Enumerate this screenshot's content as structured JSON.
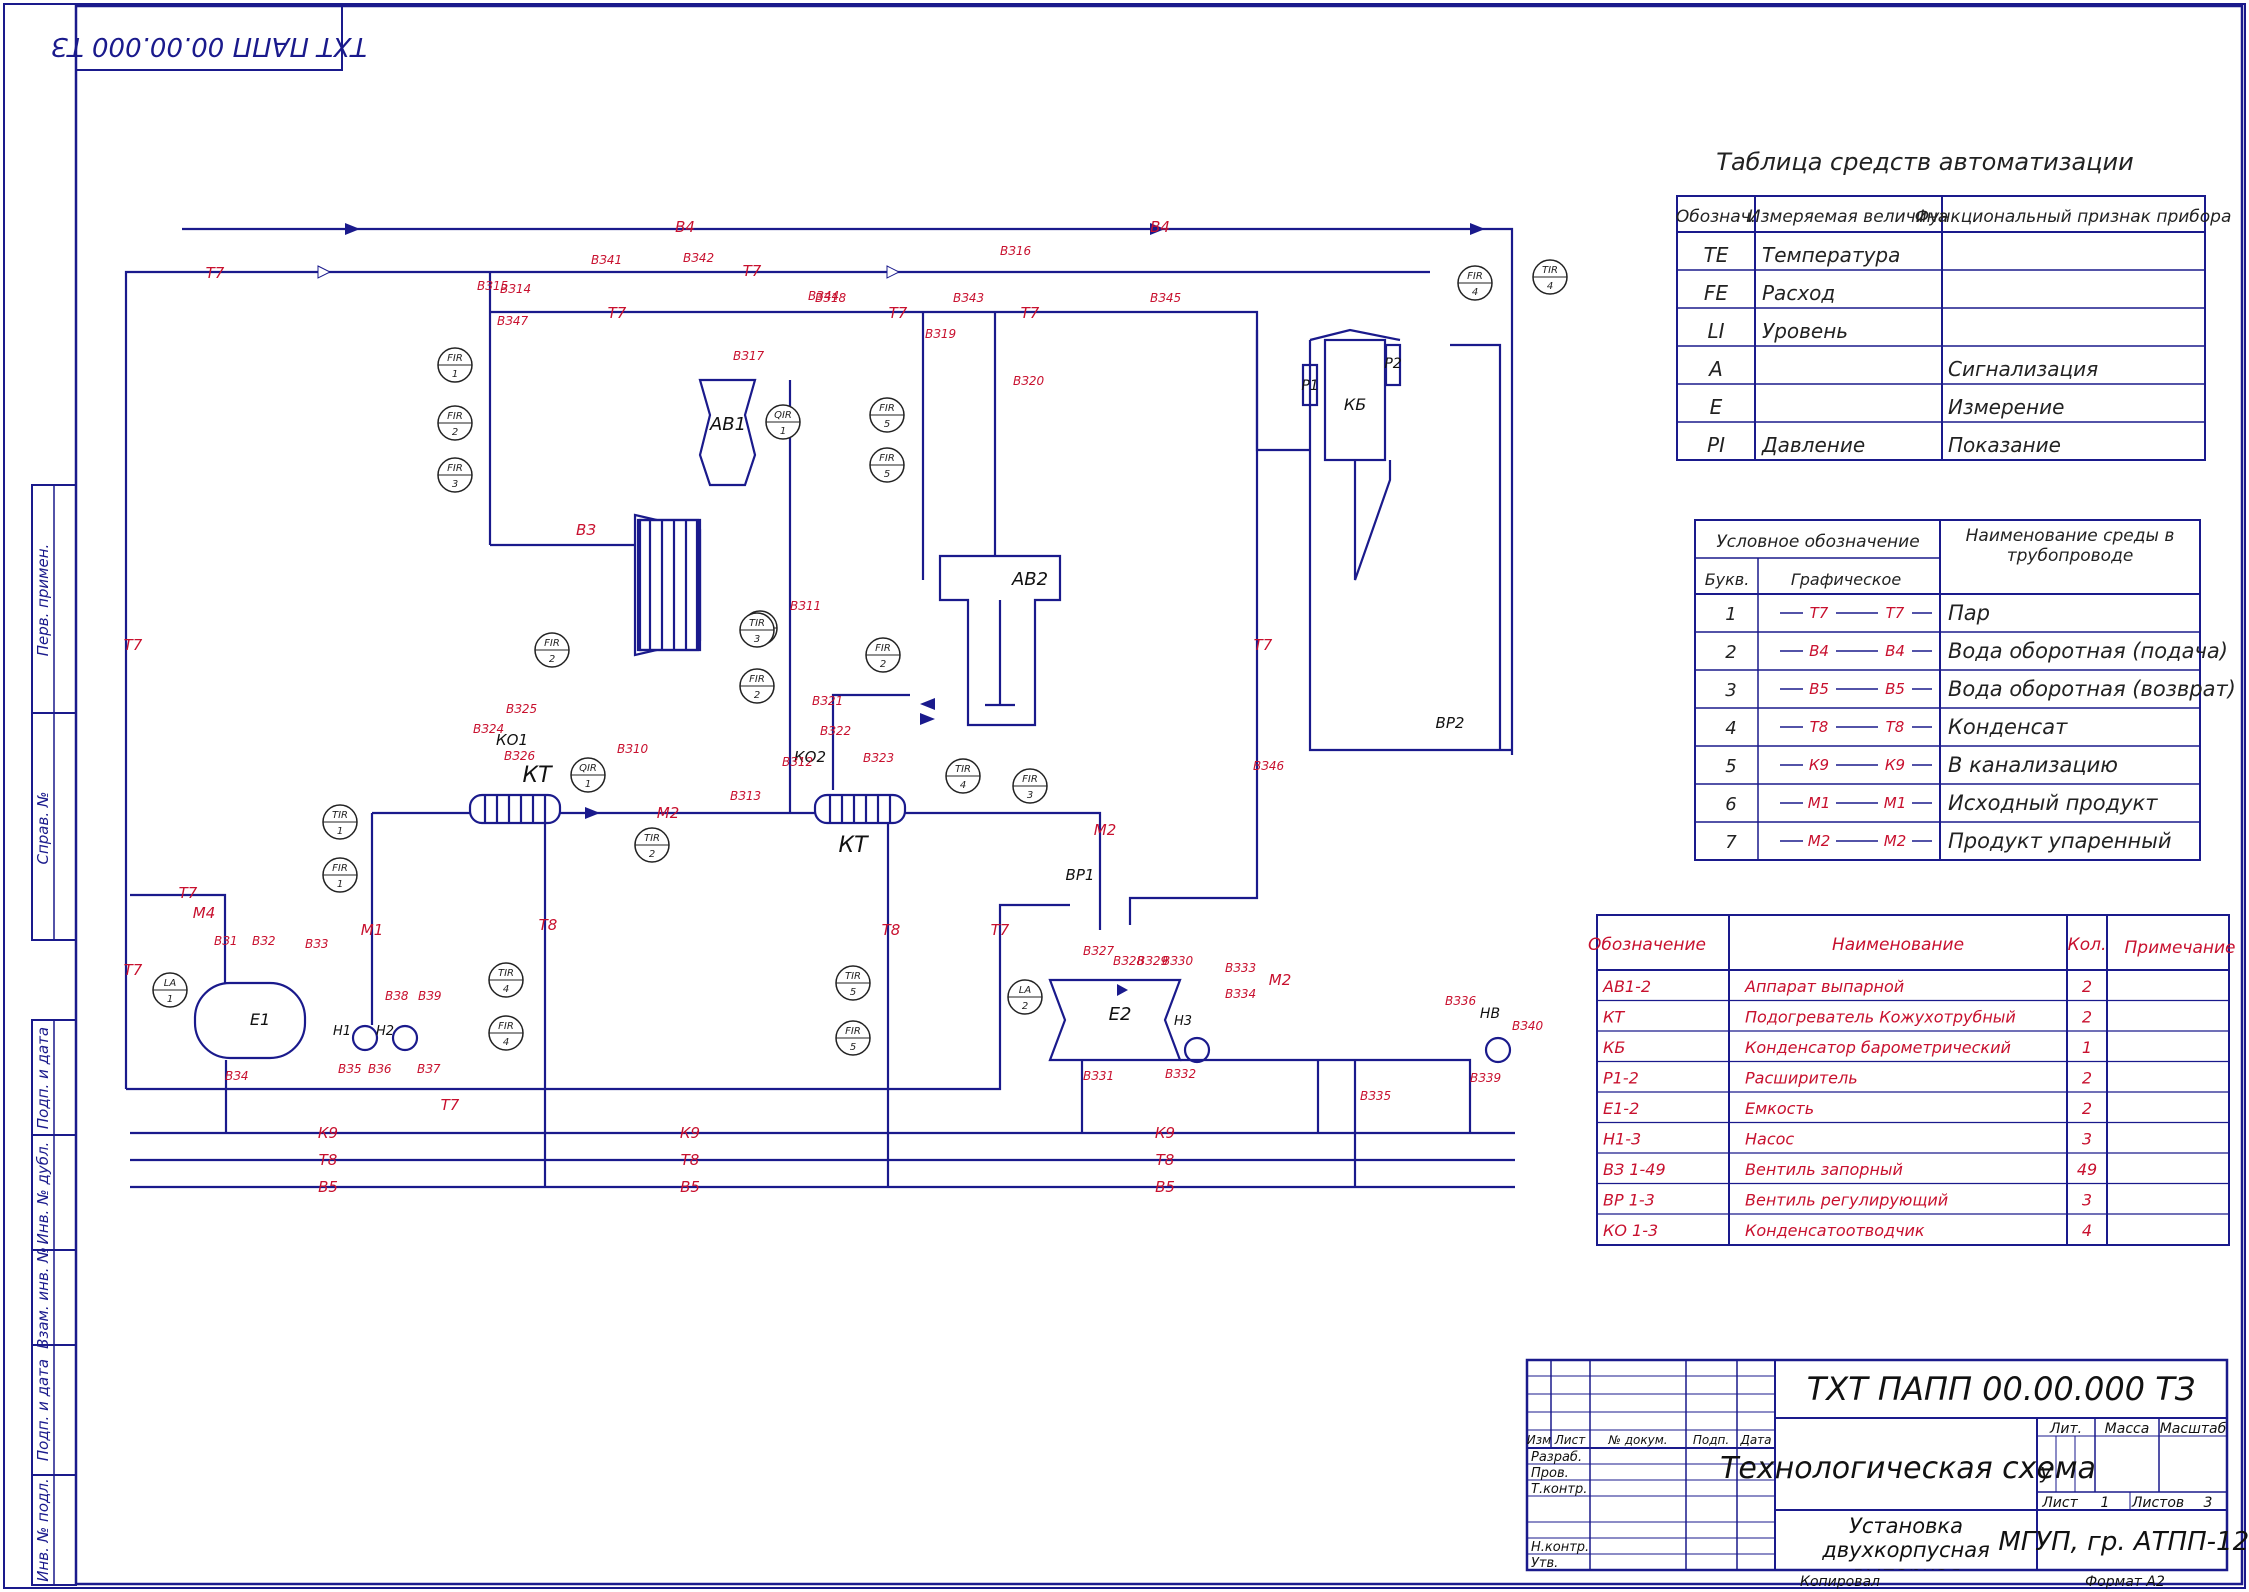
{
  "frame": {
    "top_stamp": "ТХТ ПАПП 00.00.000 ТЗ",
    "left_cols": [
      "Перв. примен.",
      "Справ. №",
      "Подп. и дата",
      "Инв. № дубл.",
      "Взам. инв. №",
      "Подп. и дата",
      "Инв. № подл."
    ]
  },
  "automation_table": {
    "title": "Таблица средств автоматизации",
    "headers": [
      "Обознач.",
      "Измеряемая величина",
      "Функциональный признак прибора"
    ],
    "rows": [
      [
        "TE",
        "Температура",
        ""
      ],
      [
        "FE",
        "Расход",
        ""
      ],
      [
        "LI",
        "Уровень",
        ""
      ],
      [
        "A",
        "",
        "Сигнализация"
      ],
      [
        "E",
        "",
        "Измерение"
      ],
      [
        "PI",
        "Давление",
        "Показание"
      ]
    ]
  },
  "media_table": {
    "header_cond": "Условное обозначение",
    "header_name": "Наименование среды в трубопроводе",
    "header_num": "Букв.",
    "header_graph": "Графическое",
    "rows": [
      {
        "num": "1",
        "code": "Т7",
        "name": "Пар"
      },
      {
        "num": "2",
        "code": "В4",
        "name": "Вода оборотная (подача)"
      },
      {
        "num": "3",
        "code": "В5",
        "name": "Вода оборотная (возврат)"
      },
      {
        "num": "4",
        "code": "Т8",
        "name": "Конденсат"
      },
      {
        "num": "5",
        "code": "К9",
        "name": "В канализацию"
      },
      {
        "num": "6",
        "code": "М1",
        "name": "Исходный продукт"
      },
      {
        "num": "7",
        "code": "М2",
        "name": "Продукт упаренный"
      }
    ]
  },
  "equipment_table": {
    "headers": [
      "Обозначение",
      "Наименование",
      "Кол.",
      "Примечание"
    ],
    "rows": [
      [
        "АВ1-2",
        "Аппарат выпарной",
        "2",
        ""
      ],
      [
        "КТ",
        "Подогреватель Кожухотрубный",
        "2",
        ""
      ],
      [
        "КБ",
        "Конденсатор барометрический",
        "1",
        ""
      ],
      [
        "Р1-2",
        "Расширитель",
        "2",
        ""
      ],
      [
        "Е1-2",
        "Емкость",
        "2",
        ""
      ],
      [
        "Н1-3",
        "Насос",
        "3",
        ""
      ],
      [
        "ВЗ 1-49",
        "Вентиль запорный",
        "49",
        ""
      ],
      [
        "ВР 1-3",
        "Вентиль регулирующий",
        "3",
        ""
      ],
      [
        "КО 1-3",
        "Конденсатоотводчик",
        "4",
        ""
      ]
    ]
  },
  "title_block": {
    "code": "ТХТ ПАПП 00.00.000 ТЗ",
    "doc_title": "Технологическая схема",
    "subject": "Установка двухкорпусная выпарная",
    "org": "МГУП, гр. АТПП-121",
    "lit_label": "Лит.",
    "lit_value": "у",
    "mass_label": "Масса",
    "scale_label": "Масштаб",
    "sheet_label": "Лист",
    "sheet_value": "1",
    "sheets_label": "Листов",
    "sheets_value": "3",
    "col_headers": [
      "Изм",
      "Лист",
      "№ докум.",
      "Подп.",
      "Дата"
    ],
    "roles": [
      "Разраб.",
      "Пров.",
      "Т.контр.",
      "Н.контр.",
      "Утв."
    ],
    "copied": "Копировал",
    "format": "Формат А2"
  },
  "diagram": {
    "equipment_labels": [
      "АВ1",
      "АВ2",
      "КБ",
      "Р1",
      "Р2",
      "КТ",
      "КТ",
      "Е1",
      "Е2",
      "Н1",
      "Н2",
      "Н3",
      "НВ",
      "КО1",
      "КО2",
      "ВР1",
      "ВР2"
    ],
    "line_labels": [
      "В4",
      "Т7",
      "Т8",
      "К9",
      "В5",
      "М1",
      "М2",
      "ВЗ"
    ],
    "instruments": [
      "FIR 1",
      "FIR 2",
      "FIR 3",
      "FIR 5",
      "FIR 4",
      "TIR 4",
      "QIR 1",
      "TIR 1",
      "TIR 2",
      "TIR 3",
      "LA 1",
      "LA 2"
    ],
    "valve_labels": [
      "ВЗ1",
      "ВЗ2",
      "ВЗ3",
      "ВЗ4",
      "ВЗ5",
      "ВЗ6",
      "ВЗ7",
      "ВЗ8",
      "ВЗ9",
      "ВЗ10",
      "ВЗ11",
      "ВЗ12",
      "ВЗ13",
      "ВЗ14",
      "ВЗ15",
      "ВЗ16",
      "ВЗ17",
      "ВЗ18",
      "ВЗ19",
      "ВЗ20",
      "ВЗ21",
      "ВЗ22",
      "ВЗ23",
      "ВЗ24",
      "ВЗ25",
      "ВЗ26",
      "ВЗ27",
      "ВЗ28",
      "ВЗ29",
      "ВЗ30",
      "ВЗ31",
      "ВЗ32",
      "ВЗ33",
      "ВЗ34",
      "ВЗ35",
      "ВЗ36",
      "ВЗ39",
      "ВЗ40",
      "ВЗ41",
      "ВЗ42",
      "ВЗ43",
      "ВЗ44",
      "ВЗ45",
      "ВЗ46",
      "ВЗ47"
    ]
  }
}
